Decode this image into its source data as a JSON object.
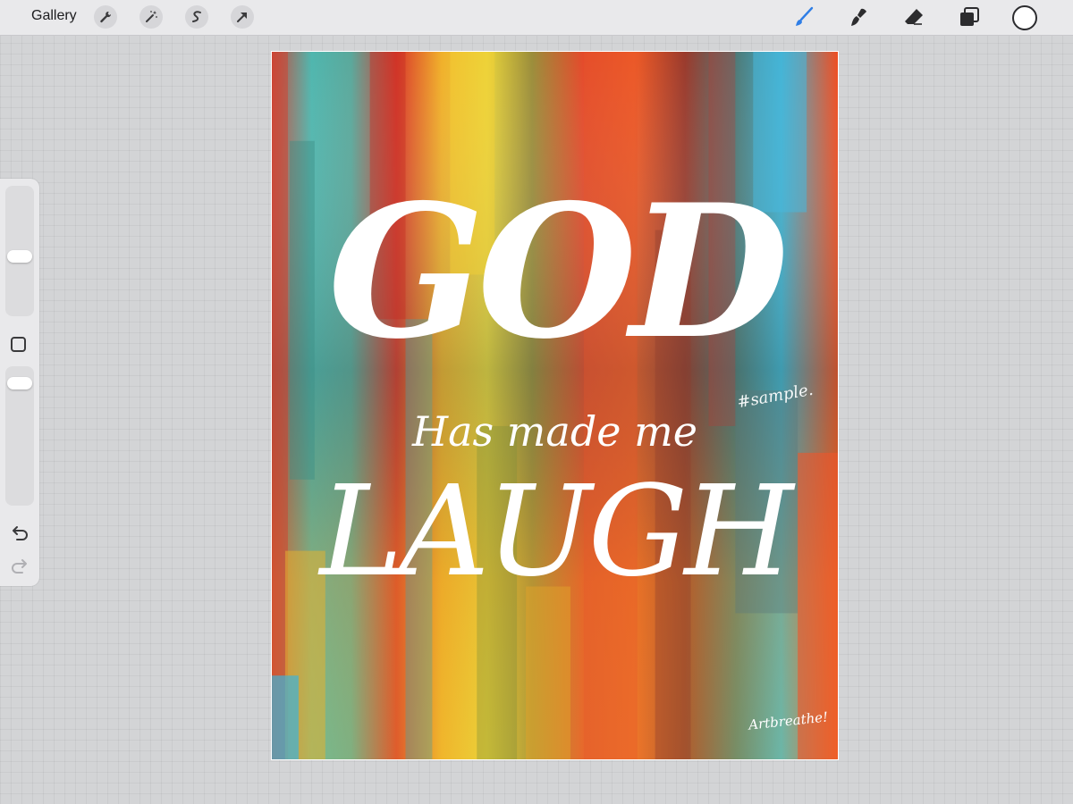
{
  "app": {
    "gallery_label": "Gallery"
  },
  "toolbar": {
    "left_tools": [
      "wrench-icon",
      "magic-wand-icon",
      "selection-icon",
      "transform-arrow-icon"
    ],
    "right_tools": [
      "brush-icon",
      "smudge-icon",
      "eraser-icon",
      "layers-icon"
    ],
    "brush_active_color": "#2f7ee6",
    "current_color": "#ffffff"
  },
  "sidebar": {
    "brush_size_level": 0.55,
    "opacity_level": 0.95
  },
  "artwork": {
    "line1": "GOD",
    "line2": "Has made me",
    "line3": "LAUGH",
    "watermark": "#sample.",
    "signature": "Artbreathe!"
  }
}
